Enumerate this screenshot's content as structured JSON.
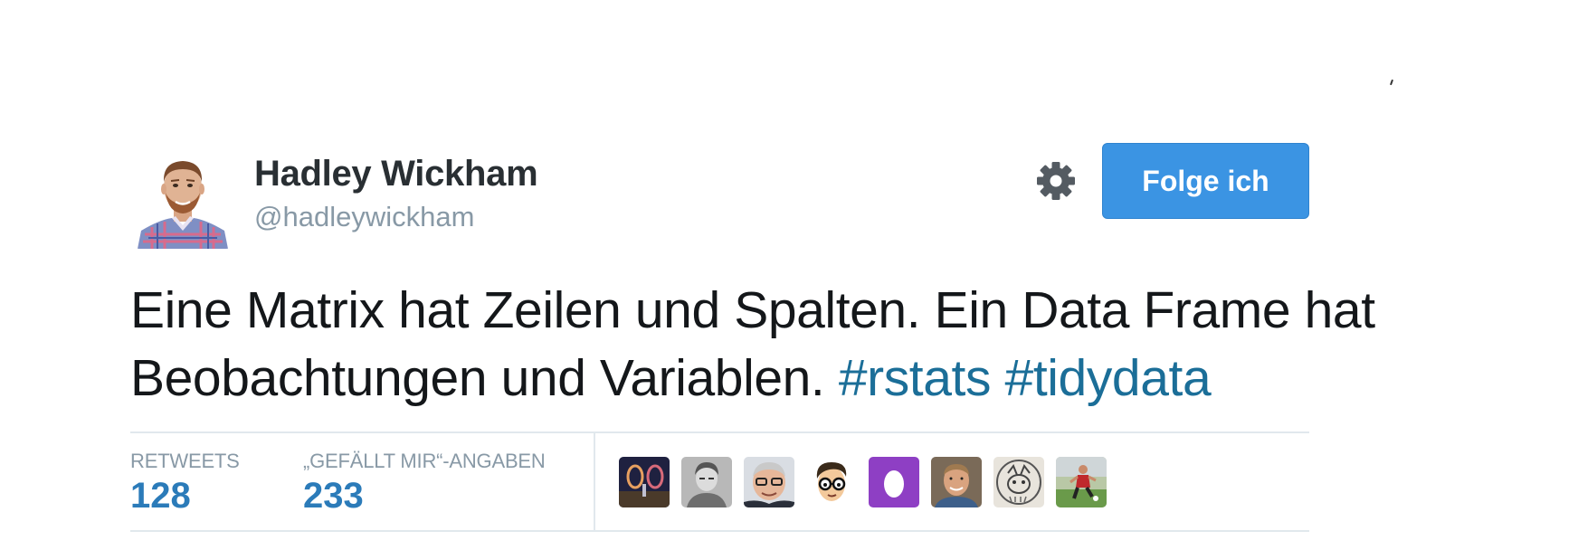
{
  "tweet": {
    "user": {
      "name": "Hadley Wickham",
      "handle": "@hadleywickham"
    },
    "follow_button_label": "Folge ich",
    "settings_icon": "gear-icon",
    "text_plain": "Eine Matrix hat Zeilen und Spalten. Ein Data Frame hat Beobachtungen und Variablen.",
    "hashtags": [
      "#rstats",
      "#tidydata"
    ],
    "stats": {
      "retweets_label": "RETWEETS",
      "retweets_count": "128",
      "likes_label": "„GEFÄLLT MIR“-ANGABEN",
      "likes_count": "233"
    },
    "liker_avatars": [
      "liker-avatar-dark-portal",
      "liker-avatar-gray-photo",
      "liker-avatar-man-glasses",
      "liker-avatar-cartoon-glasses",
      "liker-avatar-default-egg",
      "liker-avatar-man-smiling",
      "liker-avatar-sketch-animal",
      "liker-avatar-soccer-player"
    ]
  },
  "colors": {
    "follow_button": "#3b94e3",
    "hashtag": "#1b6e98",
    "stat_value": "#2b7bb9",
    "muted_text": "#8899a6",
    "egg_purple": "#8e3fc4"
  }
}
